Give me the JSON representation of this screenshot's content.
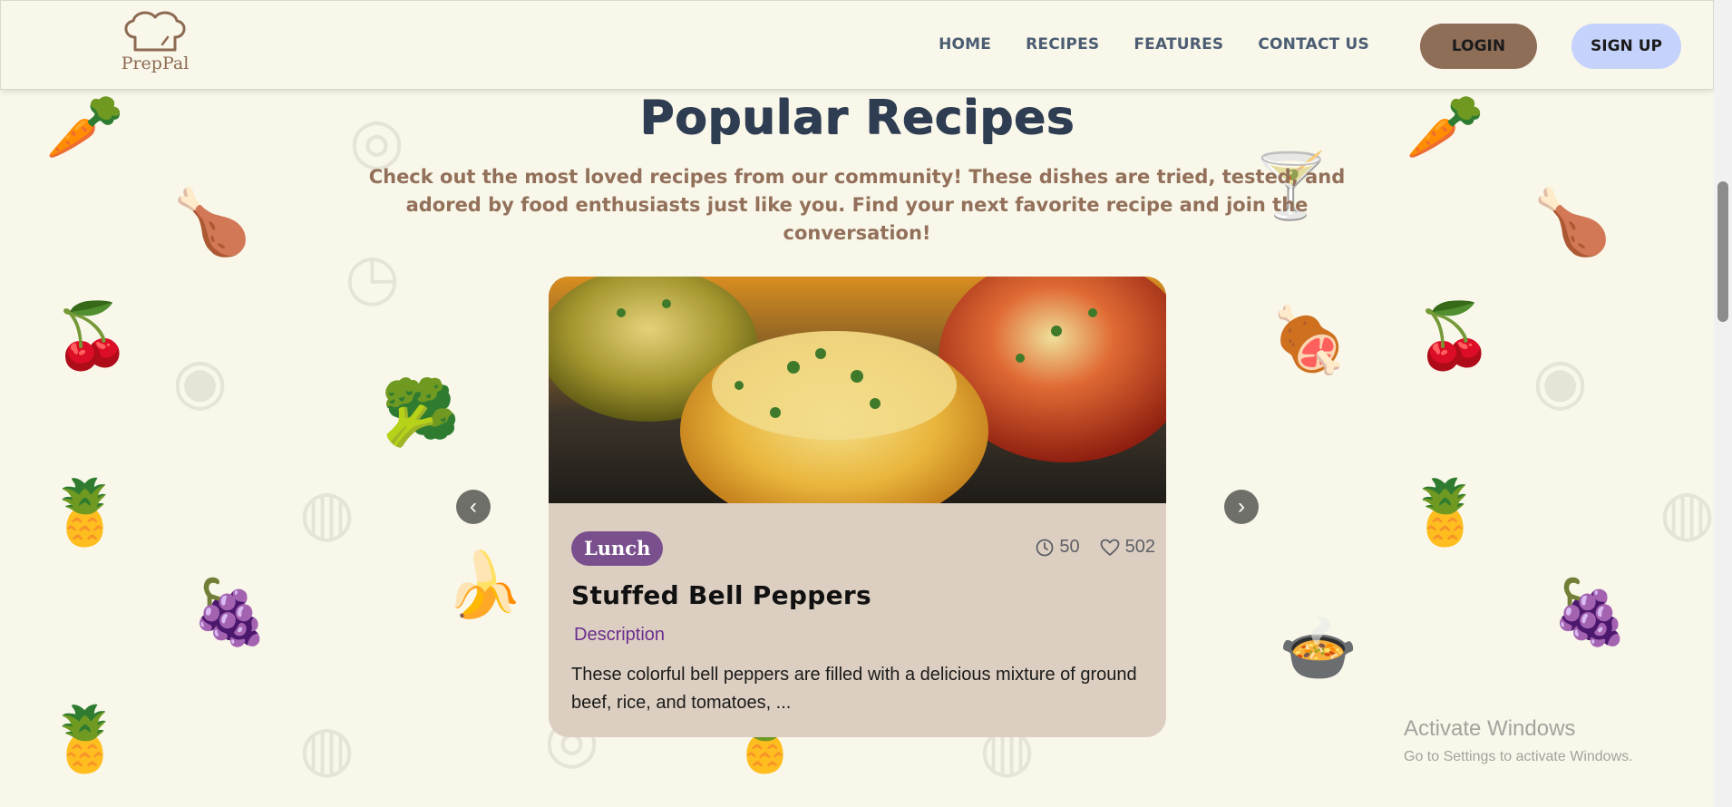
{
  "brand": {
    "logo_text": "PrepPal"
  },
  "nav": {
    "links": [
      "HOME",
      "RECIPES",
      "FEATURES",
      "CONTACT US"
    ],
    "login_label": "LOGIN",
    "signup_label": "SIGN UP"
  },
  "section": {
    "title": "Popular Recipes",
    "subtitle": "Check out the most loved recipes from our community! These dishes are tried, tested, and adored by food enthusiasts just like you. Find your next favorite recipe and join the conversation!"
  },
  "carousel": {
    "prev_label": "‹",
    "next_label": "›",
    "card": {
      "image_alt": "Stuffed bell peppers with melted cheese",
      "category": "Lunch",
      "time": "50",
      "likes": "502",
      "title": "Stuffed Bell Peppers",
      "description_label": "Description",
      "description": "These colorful bell peppers are filled with a delicious mixture of ground beef, rice, and tomatoes, ..."
    }
  },
  "watermark": {
    "title": "Activate Windows",
    "subtitle": "Go to Settings to activate Windows."
  },
  "colors": {
    "background": "#f8f7ea",
    "login": "#8f6e58",
    "signup": "#c5d2fb",
    "tag": "#7a4f8d",
    "card": "#dccfc1",
    "title": "#2f3d52",
    "subtitle": "#93705a"
  },
  "icons": [
    "chef-hat-icon",
    "clock-icon",
    "heart-icon",
    "chevron-left-icon",
    "chevron-right-icon"
  ]
}
